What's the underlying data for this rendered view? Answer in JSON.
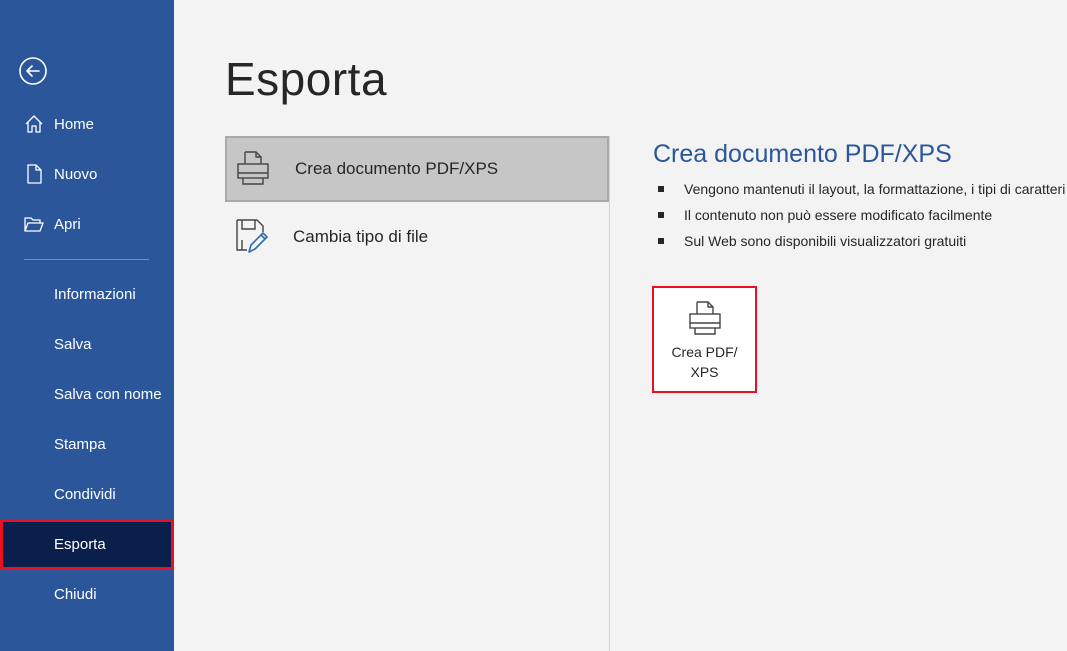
{
  "sidebar": {
    "back_icon": "back-arrow-icon",
    "background": "#2b579a",
    "active_background": "#0b1f4d",
    "items": [
      {
        "label": "Home",
        "icon": "home-icon"
      },
      {
        "label": "Nuovo",
        "icon": "new-document-icon"
      },
      {
        "label": "Apri",
        "icon": "folder-open-icon"
      },
      {
        "label": "Informazioni"
      },
      {
        "label": "Salva"
      },
      {
        "label": "Salva con nome"
      },
      {
        "label": "Stampa"
      },
      {
        "label": "Condividi"
      },
      {
        "label": "Esporta",
        "active": true
      },
      {
        "label": "Chiudi"
      }
    ]
  },
  "main": {
    "title": "Esporta",
    "options": [
      {
        "label": "Crea documento PDF/XPS",
        "icon": "pdf-printer-icon",
        "selected": true
      },
      {
        "label": "Cambia tipo di file",
        "icon": "change-file-type-icon",
        "selected": false
      }
    ]
  },
  "detail": {
    "title": "Crea documento PDF/XPS",
    "bullets": [
      "Vengono mantenuti il layout, la formattazione, i tipi di caratteri e le immagini",
      "Il contenuto non può essere modificato facilmente",
      "Sul Web sono disponibili visualizzatori gratuiti"
    ],
    "button_label": "Crea PDF/\nXPS",
    "button_icon": "pdf-printer-icon",
    "highlight_color": "#e81123",
    "accent_color": "#2b579a"
  }
}
